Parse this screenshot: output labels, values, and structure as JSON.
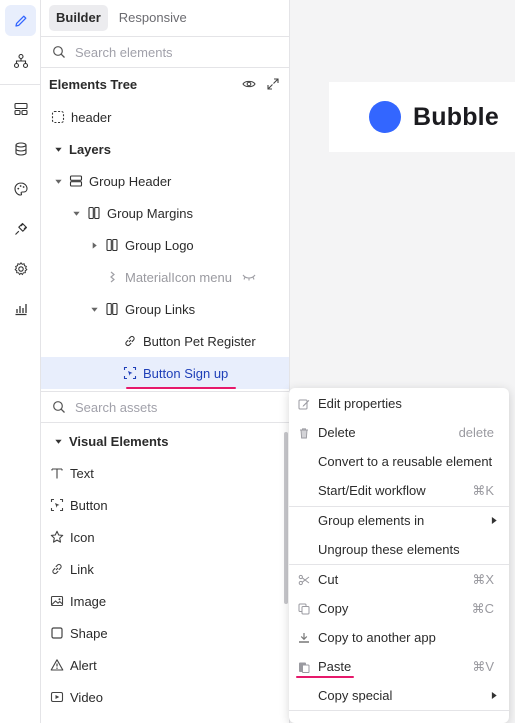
{
  "sidebar_tabs": [
    {
      "label": "Builder",
      "active": true
    },
    {
      "label": "Responsive",
      "active": false
    }
  ],
  "rail_icons": [
    "pencil-icon",
    "sitemap-icon",
    "layout-icon",
    "database-icon",
    "palette-icon",
    "plug-icon",
    "settings-icon",
    "chart-icon"
  ],
  "elements_search": {
    "placeholder": "Search elements"
  },
  "elements_tree": {
    "title": "Elements Tree",
    "items": [
      {
        "label": "header",
        "depth": 0,
        "caret": "none",
        "icon": "page-icon"
      },
      {
        "label": "Layers",
        "depth": 0,
        "caret": "down",
        "icon": "none",
        "bold": true
      },
      {
        "label": "Group Header",
        "depth": 1,
        "caret": "down",
        "icon": "group-icon"
      },
      {
        "label": "Group Margins",
        "depth": 2,
        "caret": "down",
        "icon": "columns-icon"
      },
      {
        "label": "Group Logo",
        "depth": 3,
        "caret": "right",
        "icon": "columns-icon"
      },
      {
        "label": "MaterialIcon menu",
        "depth": 3,
        "caret": "none",
        "icon": "material-icon",
        "muted": true,
        "hidden_marker": true
      },
      {
        "label": "Group Links",
        "depth": 3,
        "caret": "down",
        "icon": "columns-icon"
      },
      {
        "label": "Button Pet Register",
        "depth": 4,
        "caret": "none",
        "icon": "link-icon"
      },
      {
        "label": "Button Sign up",
        "depth": 4,
        "caret": "none",
        "icon": "button-icon",
        "selected": true
      }
    ]
  },
  "assets_search": {
    "placeholder": "Search assets"
  },
  "visual_elements": {
    "title": "Visual Elements",
    "items": [
      {
        "label": "Text",
        "icon": "text-icon"
      },
      {
        "label": "Button",
        "icon": "button-icon"
      },
      {
        "label": "Icon",
        "icon": "star-icon"
      },
      {
        "label": "Link",
        "icon": "link-icon"
      },
      {
        "label": "Image",
        "icon": "image-icon"
      },
      {
        "label": "Shape",
        "icon": "square-icon"
      },
      {
        "label": "Alert",
        "icon": "alert-icon"
      },
      {
        "label": "Video",
        "icon": "video-icon"
      }
    ]
  },
  "canvas": {
    "logo_text": "Bubble",
    "logo_color": "#3366ff"
  },
  "context_menu": {
    "items": [
      {
        "label": "Edit properties",
        "icon": "edit-icon",
        "shortcut": ""
      },
      {
        "label": "Delete",
        "icon": "trash-icon",
        "shortcut": "delete"
      },
      {
        "label": "Convert to a reusable element",
        "icon": "",
        "shortcut": ""
      },
      {
        "label": "Start/Edit workflow",
        "icon": "",
        "shortcut": "⌘K"
      },
      {
        "label": "Group elements in",
        "icon": "",
        "shortcut": "",
        "submenu": true
      },
      {
        "label": "Ungroup these elements",
        "icon": "",
        "shortcut": ""
      },
      {
        "label": "Cut",
        "icon": "scissors-icon",
        "shortcut": "⌘X"
      },
      {
        "label": "Copy",
        "icon": "copy-icon",
        "shortcut": "⌘C"
      },
      {
        "label": "Copy to another app",
        "icon": "download-icon",
        "shortcut": ""
      },
      {
        "label": "Paste",
        "icon": "paste-icon",
        "shortcut": "⌘V"
      },
      {
        "label": "Copy special",
        "icon": "",
        "shortcut": "",
        "submenu": true
      }
    ]
  },
  "accent_colors": {
    "selection": "#e8eefc",
    "highlight_underline": "#e6196b",
    "brand_blue": "#3366ff"
  }
}
